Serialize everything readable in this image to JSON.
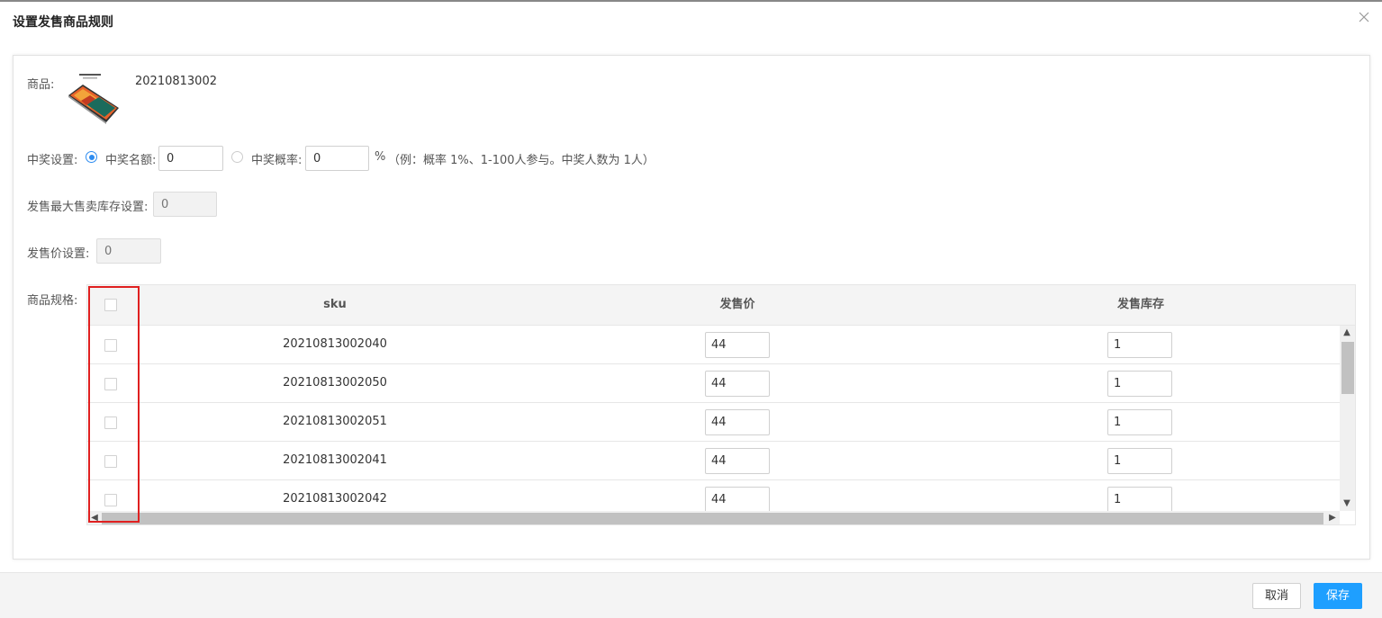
{
  "dialog": {
    "title": "设置发售商品规则"
  },
  "product": {
    "label": "商品:",
    "code": "20210813002"
  },
  "prize": {
    "label": "中奖设置:",
    "option_count_label": "中奖名额:",
    "option_count_selected": true,
    "count_value": "0",
    "option_rate_label": "中奖概率:",
    "option_rate_selected": false,
    "rate_value": "0",
    "percent_sign": "%",
    "hint": "（例：概率 1%、1-100人参与。中奖人数为 1人）"
  },
  "max_stock": {
    "label": "发售最大售卖库存设置:",
    "placeholder": "0"
  },
  "price": {
    "label": "发售价设置:",
    "placeholder": "0"
  },
  "spec_table": {
    "label": "商品规格:",
    "headers": {
      "sku": "sku",
      "price": "发售价",
      "stock": "发售库存"
    },
    "rows": [
      {
        "sku": "20210813002040",
        "price": "44",
        "stock": "1"
      },
      {
        "sku": "20210813002050",
        "price": "44",
        "stock": "1"
      },
      {
        "sku": "20210813002051",
        "price": "44",
        "stock": "1"
      },
      {
        "sku": "20210813002041",
        "price": "44",
        "stock": "1"
      },
      {
        "sku": "20210813002042",
        "price": "44",
        "stock": "1"
      }
    ]
  },
  "footer": {
    "cancel_label": "取消",
    "save_label": "保存"
  },
  "colors": {
    "accent": "#1e9fff",
    "radio": "#2d8cf0",
    "highlight": "#e02020"
  }
}
